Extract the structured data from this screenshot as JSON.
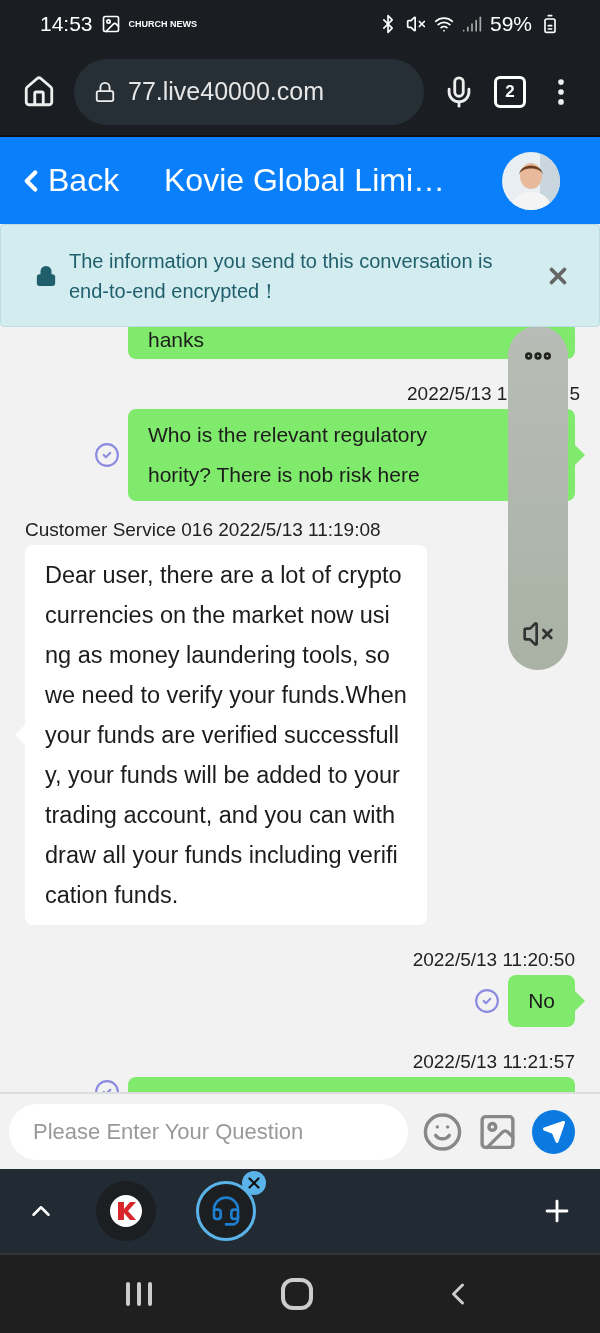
{
  "status_bar": {
    "time": "14:53",
    "notification_label": "CHURCH NEWS",
    "battery": "59%"
  },
  "browser": {
    "url": "77.live40000.com",
    "tab_count": "2"
  },
  "header": {
    "back": "Back",
    "title": "Kovie Global Limi…"
  },
  "banner": {
    "text": "The information you send to this conversation is end-to-end encrypted！"
  },
  "chat": {
    "items": [
      {
        "kind": "sent_partial",
        "lines": [
          "hanks"
        ]
      },
      {
        "kind": "time",
        "parts": [
          "2022/5/13 1",
          "5"
        ]
      },
      {
        "kind": "sent",
        "lines": [
          "Who is the relevant regulatory",
          "hority? There is nob risk here"
        ],
        "read": true
      },
      {
        "kind": "sender",
        "text": "Customer Service 016 2022/5/13 11:19:08"
      },
      {
        "kind": "received",
        "lines": [
          "Dear user, there are a lot of crypto",
          "currencies on the market now usi",
          "ng as money laundering tools, so",
          "we need to verify your funds.When",
          "your funds are verified successfull",
          "y, your funds will be added to your",
          "trading account, and you can with",
          "draw all your funds including verifi",
          "cation funds."
        ]
      },
      {
        "kind": "time",
        "parts": [
          "2022/5/13 11:20:50"
        ]
      },
      {
        "kind": "sent",
        "lines": [
          "No"
        ],
        "read": true
      },
      {
        "kind": "time",
        "parts": [
          "2022/5/13 11:21:57"
        ]
      },
      {
        "kind": "sent_cut",
        "read": true
      }
    ]
  },
  "floating_panel": {
    "muted": true
  },
  "composer": {
    "placeholder": "Please Enter Your Question"
  },
  "app_tabs": [
    {
      "kind": "logo",
      "selected": false
    },
    {
      "kind": "support",
      "selected": true
    }
  ]
}
